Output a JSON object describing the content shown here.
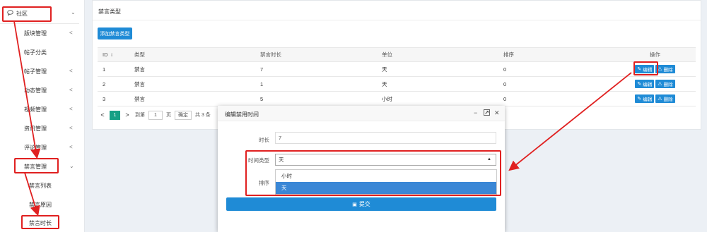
{
  "sidebar": {
    "top": {
      "icon": "chat-icon",
      "label": "社区"
    },
    "items": [
      {
        "label": "版块管理",
        "chevron": "<"
      },
      {
        "label": "帖子分类",
        "chevron": ""
      },
      {
        "label": "帖子管理",
        "chevron": "<"
      },
      {
        "label": "动态管理",
        "chevron": "<"
      },
      {
        "label": "视频管理",
        "chevron": "<"
      },
      {
        "label": "资讯管理",
        "chevron": "<"
      },
      {
        "label": "评论管理",
        "chevron": "<"
      },
      {
        "label": "禁言管理",
        "chevron": "v"
      }
    ],
    "sub_items": [
      {
        "label": "禁言列表"
      },
      {
        "label": "禁言原因"
      },
      {
        "label": "禁言时长"
      }
    ]
  },
  "panel": {
    "title": "禁言类型",
    "add_button": "添加禁言类型",
    "columns": [
      "ID",
      "类型",
      "禁言时长",
      "单位",
      "排序",
      "操作"
    ],
    "rows": [
      {
        "id": "1",
        "type": "禁言",
        "duration": "7",
        "unit": "天",
        "sort": "0"
      },
      {
        "id": "2",
        "type": "禁言",
        "duration": "1",
        "unit": "天",
        "sort": "0"
      },
      {
        "id": "3",
        "type": "禁言",
        "duration": "5",
        "unit": "小时",
        "sort": "0"
      }
    ],
    "edit_label": "编辑",
    "delete_label": "删除",
    "pager": {
      "prev": "<",
      "current": "1",
      "next": ">",
      "goto": "到第",
      "page_value": "1",
      "page_unit": "页",
      "confirm": "确定",
      "total": "共 3 条"
    }
  },
  "modal": {
    "title": "编辑禁用时间",
    "fields": {
      "duration_label": "时长",
      "duration_value": "7",
      "type_label": "时间类型",
      "type_value": "天",
      "sort_label": "排序"
    },
    "options": [
      "小时",
      "天"
    ],
    "selected_option": "天",
    "submit": "提交"
  },
  "colors": {
    "primary": "#1f8bd6",
    "pager_active": "#16a085",
    "annotation": "#e02020",
    "selected": "#3a87d6"
  }
}
